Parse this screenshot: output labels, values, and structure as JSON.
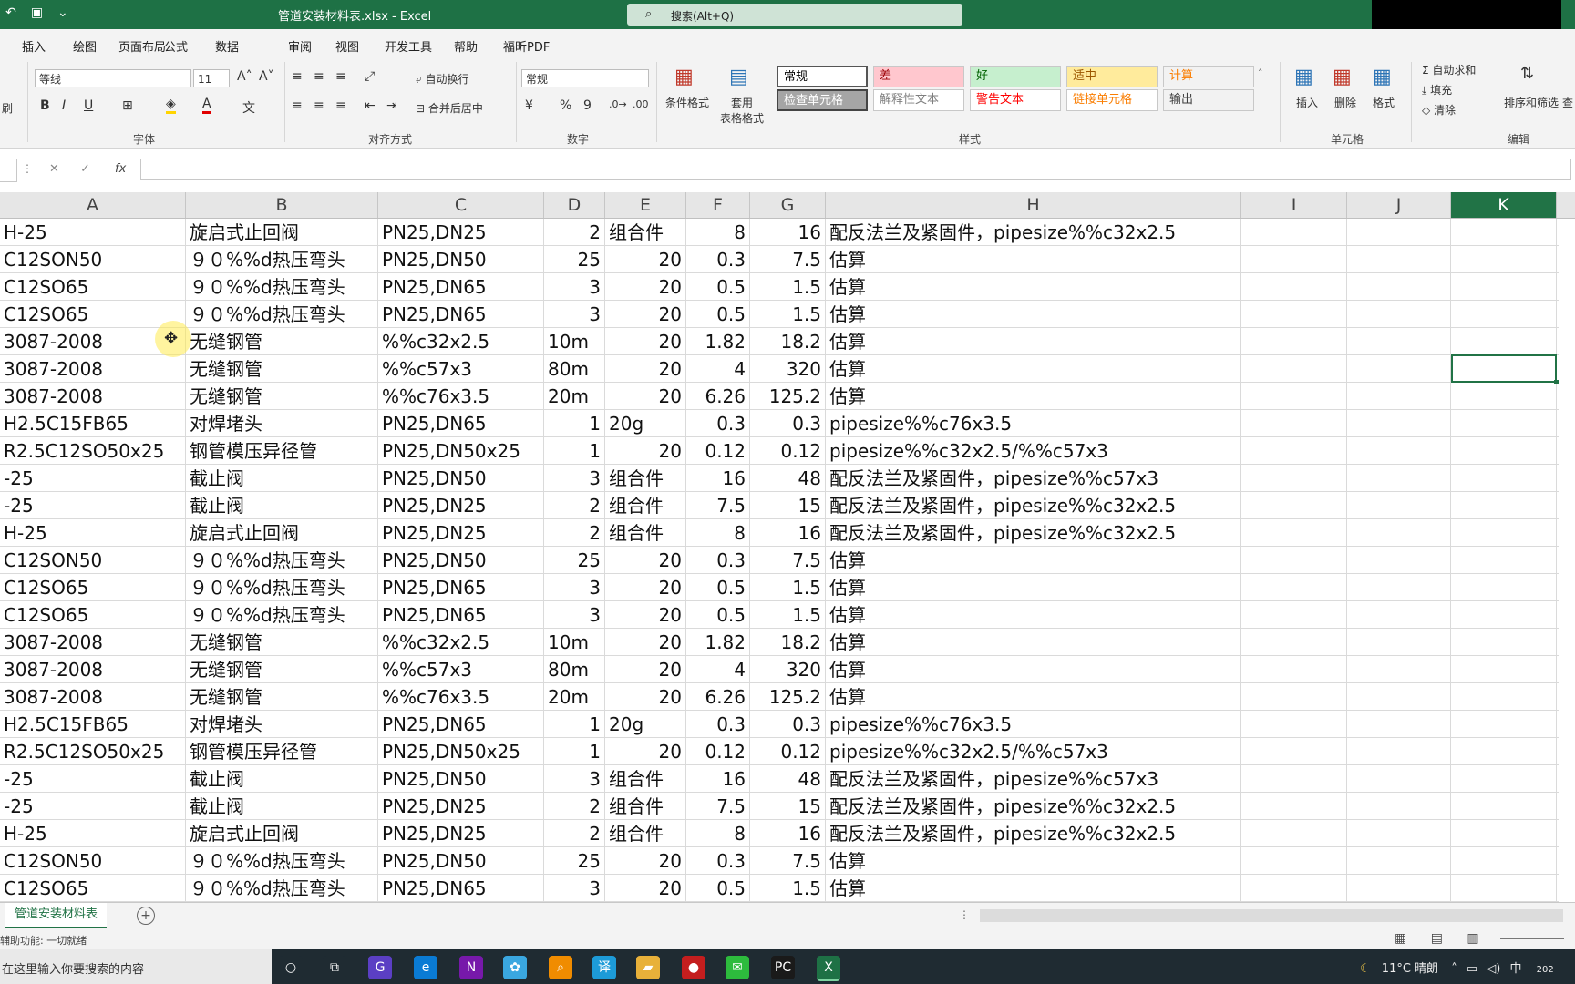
{
  "app": {
    "title": "管道安装材料表.xlsx  -  Excel",
    "search_placeholder": "搜索(Alt+Q)",
    "qat_icons": [
      "undo-icon",
      "save-icon",
      "customize-icon"
    ]
  },
  "tabs": [
    "插入",
    "绘图",
    "页面布局",
    "公式",
    "数据",
    "审阅",
    "视图",
    "开发工具",
    "帮助",
    "福昕PDF"
  ],
  "ribbon": {
    "font_name": "等线",
    "font_size": "11",
    "font_buttons": [
      "B",
      "I",
      "U"
    ],
    "group_font": "字体",
    "wrap_text": "自动换行",
    "merge_center": "合并后居中",
    "group_align": "对齐方式",
    "number_format": "常规",
    "group_number": "数字",
    "percent": "%",
    "comma": "9",
    "cond_format": "条件格式",
    "table_format_1": "套用",
    "table_format_2": "表格格式",
    "styles": [
      {
        "label": "常规",
        "bg": "#ffffff",
        "color": "#000000"
      },
      {
        "label": "差",
        "bg": "#ffc7ce",
        "color": "#9c0006"
      },
      {
        "label": "好",
        "bg": "#c6efce",
        "color": "#006100"
      },
      {
        "label": "适中",
        "bg": "#ffeb9c",
        "color": "#9c5700"
      },
      {
        "label": "计算",
        "bg": "#f2f2f2",
        "color": "#fa7d00"
      },
      {
        "label": "检查单元格",
        "bg": "#a5a5a5",
        "color": "#ffffff"
      },
      {
        "label": "解释性文本",
        "bg": "#ffffff",
        "color": "#7f7f7f"
      },
      {
        "label": "警告文本",
        "bg": "#ffffff",
        "color": "#ff0000"
      },
      {
        "label": "链接单元格",
        "bg": "#ffffff",
        "color": "#fa7d00"
      },
      {
        "label": "输出",
        "bg": "#f2f2f2",
        "color": "#3f3f3f"
      }
    ],
    "group_styles": "样式",
    "insert": "插入",
    "delete": "删除",
    "format": "格式",
    "group_cells": "单元格",
    "autosum": "自动求和",
    "fill": "填充",
    "clear": "清除",
    "sort_filter": "排序和筛选",
    "find": "查",
    "group_edit": "编辑",
    "left_cut": "刷"
  },
  "formula_bar": {
    "fx": "fx",
    "cancel": "✕",
    "confirm": "✓"
  },
  "columns": [
    {
      "label": "A"
    },
    {
      "label": "B"
    },
    {
      "label": "C"
    },
    {
      "label": "D"
    },
    {
      "label": "E"
    },
    {
      "label": "F"
    },
    {
      "label": "G"
    },
    {
      "label": "H"
    },
    {
      "label": "I"
    },
    {
      "label": "J"
    },
    {
      "label": "K",
      "selected": true
    }
  ],
  "rows": [
    [
      "H-25",
      "旋启式止回阀",
      "PN25,DN25",
      "2",
      "组合件",
      "8",
      "16",
      "配反法兰及紧固件，pipesize%%c32x2.5"
    ],
    [
      "C12SON50",
      "９０%%d热压弯头",
      "PN25,DN50",
      "25",
      "20",
      "0.3",
      "7.5",
      "估算"
    ],
    [
      "C12SO65",
      "９０%%d热压弯头",
      "PN25,DN65",
      "3",
      "20",
      "0.5",
      "1.5",
      "估算"
    ],
    [
      "C12SO65",
      "９０%%d热压弯头",
      "PN25,DN65",
      "3",
      "20",
      "0.5",
      "1.5",
      "估算"
    ],
    [
      "3087-2008",
      "无缝钢管",
      "%%c32x2.5",
      "10m",
      "20",
      "1.82",
      "18.2",
      "估算"
    ],
    [
      "3087-2008",
      "无缝钢管",
      "%%c57x3",
      "80m",
      "20",
      "4",
      "320",
      "估算"
    ],
    [
      "3087-2008",
      "无缝钢管",
      "%%c76x3.5",
      "20m",
      "20",
      "6.26",
      "125.2",
      "估算"
    ],
    [
      "H2.5C15FB65",
      "对焊堵头",
      "PN25,DN65",
      "1",
      "20g",
      "0.3",
      "0.3",
      "pipesize%%c76x3.5"
    ],
    [
      "R2.5C12SO50x25",
      "钢管模压异径管",
      "PN25,DN50x25",
      "1",
      "20",
      "0.12",
      "0.12",
      "pipesize%%c32x2.5/%%c57x3"
    ],
    [
      "-25",
      "截止阀",
      "PN25,DN50",
      "3",
      "组合件",
      "16",
      "48",
      "配反法兰及紧固件，pipesize%%c57x3"
    ],
    [
      "-25",
      "截止阀",
      "PN25,DN25",
      "2",
      "组合件",
      "7.5",
      "15",
      "配反法兰及紧固件，pipesize%%c32x2.5"
    ],
    [
      "H-25",
      "旋启式止回阀",
      "PN25,DN25",
      "2",
      "组合件",
      "8",
      "16",
      "配反法兰及紧固件，pipesize%%c32x2.5"
    ],
    [
      "C12SON50",
      "９０%%d热压弯头",
      "PN25,DN50",
      "25",
      "20",
      "0.3",
      "7.5",
      "估算"
    ],
    [
      "C12SO65",
      "９０%%d热压弯头",
      "PN25,DN65",
      "3",
      "20",
      "0.5",
      "1.5",
      "估算"
    ],
    [
      "C12SO65",
      "９０%%d热压弯头",
      "PN25,DN65",
      "3",
      "20",
      "0.5",
      "1.5",
      "估算"
    ],
    [
      "3087-2008",
      "无缝钢管",
      "%%c32x2.5",
      "10m",
      "20",
      "1.82",
      "18.2",
      "估算"
    ],
    [
      "3087-2008",
      "无缝钢管",
      "%%c57x3",
      "80m",
      "20",
      "4",
      "320",
      "估算"
    ],
    [
      "3087-2008",
      "无缝钢管",
      "%%c76x3.5",
      "20m",
      "20",
      "6.26",
      "125.2",
      "估算"
    ],
    [
      "H2.5C15FB65",
      "对焊堵头",
      "PN25,DN65",
      "1",
      "20g",
      "0.3",
      "0.3",
      "pipesize%%c76x3.5"
    ],
    [
      "R2.5C12SO50x25",
      "钢管模压异径管",
      "PN25,DN50x25",
      "1",
      "20",
      "0.12",
      "0.12",
      "pipesize%%c32x2.5/%%c57x3"
    ],
    [
      "-25",
      "截止阀",
      "PN25,DN50",
      "3",
      "组合件",
      "16",
      "48",
      "配反法兰及紧固件，pipesize%%c57x3"
    ],
    [
      "-25",
      "截止阀",
      "PN25,DN25",
      "2",
      "组合件",
      "7.5",
      "15",
      "配反法兰及紧固件，pipesize%%c32x2.5"
    ],
    [
      "H-25",
      "旋启式止回阀",
      "PN25,DN25",
      "2",
      "组合件",
      "8",
      "16",
      "配反法兰及紧固件，pipesize%%c32x2.5"
    ],
    [
      "C12SON50",
      "９０%%d热压弯头",
      "PN25,DN50",
      "25",
      "20",
      "0.3",
      "7.5",
      "估算"
    ],
    [
      "C12SO65",
      "９０%%d热压弯头",
      "PN25,DN65",
      "3",
      "20",
      "0.5",
      "1.5",
      "估算"
    ]
  ],
  "sheet_tab": "管道安装材料表",
  "status": "辅助功能: 一切就绪",
  "taskbar": {
    "search_placeholder": "在这里输入你要搜索的内容",
    "apps": [
      {
        "name": "cortana-icon",
        "glyph": "○",
        "bg": "#1f2b32"
      },
      {
        "name": "task-view-icon",
        "glyph": "⧉",
        "bg": "#1f2b32"
      },
      {
        "name": "app-g-icon",
        "glyph": "G",
        "bg": "#5b3fc4"
      },
      {
        "name": "edge-icon",
        "glyph": "e",
        "bg": "#0a7bd4"
      },
      {
        "name": "onenote-icon",
        "glyph": "N",
        "bg": "#7719aa"
      },
      {
        "name": "app-flower-icon",
        "glyph": "✿",
        "bg": "#3aa7e0"
      },
      {
        "name": "search-app-icon",
        "glyph": "⌕",
        "bg": "#f08c00"
      },
      {
        "name": "translate-icon",
        "glyph": "译",
        "bg": "#1d9bd8"
      },
      {
        "name": "file-explorer-icon",
        "glyph": "▰",
        "bg": "#e8b13a"
      },
      {
        "name": "record-icon",
        "glyph": "●",
        "bg": "#c41e1e"
      },
      {
        "name": "wechat-icon",
        "glyph": "✉",
        "bg": "#2dbb3d"
      },
      {
        "name": "pycharm-icon",
        "glyph": "PC",
        "bg": "#1a1a1a"
      },
      {
        "name": "excel-icon",
        "glyph": "X",
        "bg": "#1e7145"
      }
    ],
    "weather": "11°C 晴朗",
    "ime": "中",
    "year_stub": "202"
  }
}
